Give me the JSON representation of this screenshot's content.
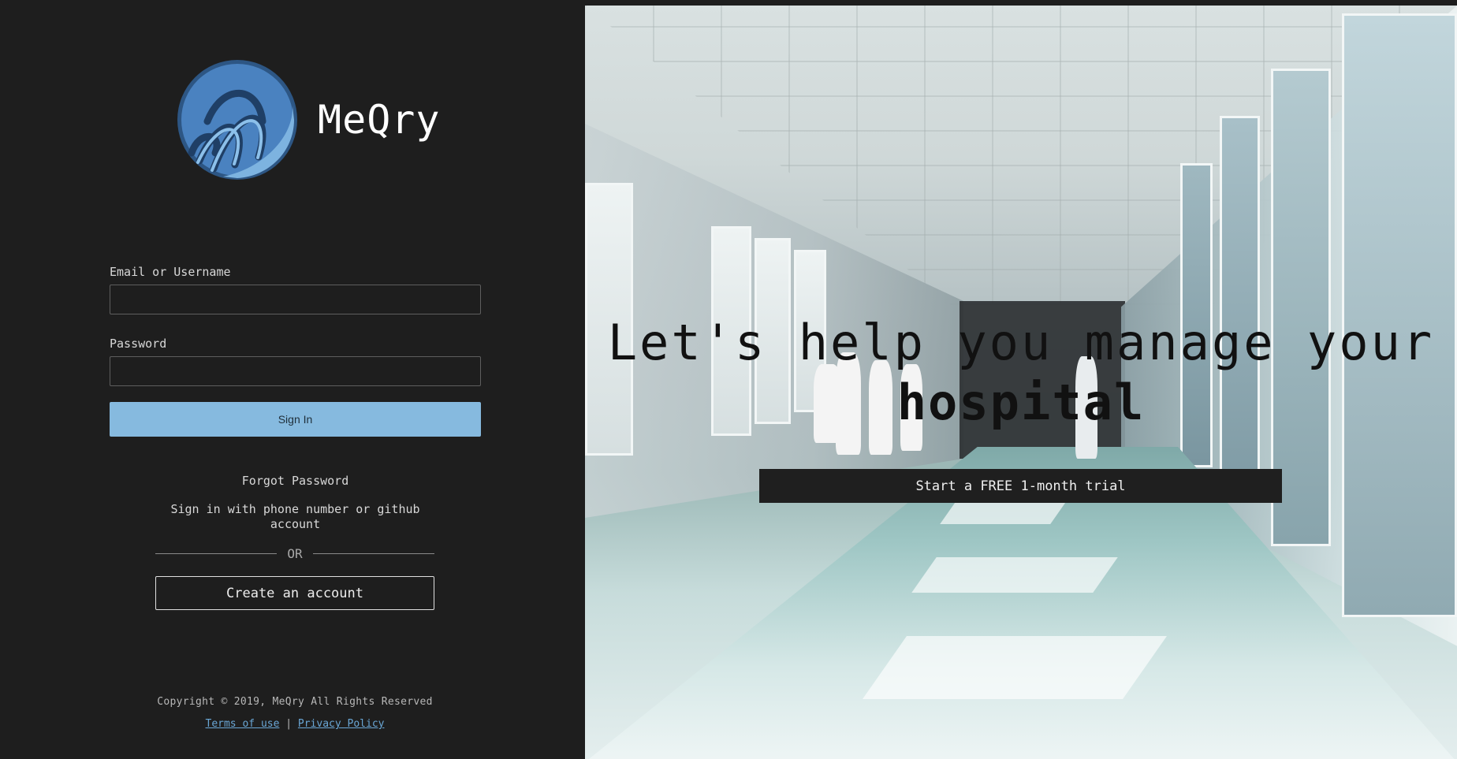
{
  "brand": {
    "name": "MeQry",
    "logo_icon": "wave-circle-logo-icon"
  },
  "login": {
    "email_label": "Email or Username",
    "email_value": "",
    "password_label": "Password",
    "password_value": "",
    "signin_label": "Sign In",
    "forgot_label": "Forgot Password",
    "alt_signin_text": "Sign in with phone number or github account",
    "or_text": "OR",
    "create_label": "Create an account"
  },
  "footer": {
    "copyright": "Copyright © 2019, MeQry All Rights Reserved",
    "terms_label": "Terms of use",
    "separator": "|",
    "privacy_label": "Privacy Policy"
  },
  "hero": {
    "headline_line1": "Let's help you manage your",
    "headline_line2": "hospital",
    "cta_label": "Start a FREE 1-month trial"
  },
  "colors": {
    "background": "#1e1e1e",
    "signin_button": "#86badf",
    "logo_blue": "#4a82c0",
    "link": "#6aa7d6"
  }
}
